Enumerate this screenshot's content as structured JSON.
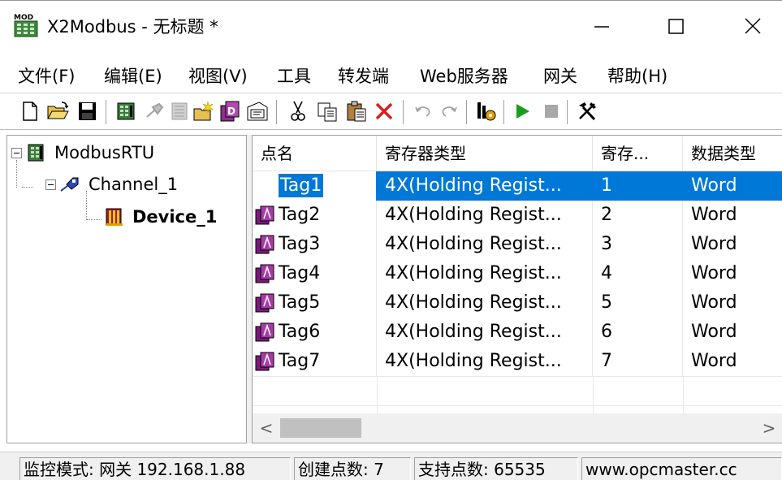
{
  "window": {
    "title": "X2Modbus - 无标题 *",
    "minimize_icon": "minimize-icon",
    "maximize_icon": "maximize-icon",
    "close_icon": "close-icon"
  },
  "menu": {
    "items": [
      {
        "label": "文件(F)"
      },
      {
        "label": "编辑(E)"
      },
      {
        "label": "视图(V)"
      },
      {
        "label": "工具"
      },
      {
        "label": "转发端"
      },
      {
        "label": "Web服务器"
      },
      {
        "label": "网关"
      },
      {
        "label": "帮助(H)"
      }
    ]
  },
  "toolbar": {
    "buttons": [
      "new-icon",
      "open-icon",
      "save-icon",
      "channel-icon",
      "link-icon",
      "device-icon",
      "new-tag-icon",
      "tag-db-icon",
      "properties-icon",
      "cut-icon",
      "copy-icon",
      "paste-icon",
      "delete-icon",
      "undo-icon",
      "redo-icon",
      "run-config-icon",
      "start-icon",
      "stop-icon",
      "tools-icon"
    ]
  },
  "tree": {
    "root": {
      "label": "ModbusRTU"
    },
    "channel": {
      "label": "Channel_1"
    },
    "device": {
      "label": "Device_1"
    }
  },
  "list": {
    "headers": [
      "点名",
      "寄存器类型",
      "寄存...",
      "数据类型"
    ],
    "rows": [
      {
        "name": "Tag1",
        "register_type": "4X(Holding Regist...",
        "address": "1",
        "data_type": "Word"
      },
      {
        "name": "Tag2",
        "register_type": "4X(Holding Regist...",
        "address": "2",
        "data_type": "Word"
      },
      {
        "name": "Tag3",
        "register_type": "4X(Holding Regist...",
        "address": "3",
        "data_type": "Word"
      },
      {
        "name": "Tag4",
        "register_type": "4X(Holding Regist...",
        "address": "4",
        "data_type": "Word"
      },
      {
        "name": "Tag5",
        "register_type": "4X(Holding Regist...",
        "address": "5",
        "data_type": "Word"
      },
      {
        "name": "Tag6",
        "register_type": "4X(Holding Regist...",
        "address": "6",
        "data_type": "Word"
      },
      {
        "name": "Tag7",
        "register_type": "4X(Holding Regist...",
        "address": "7",
        "data_type": "Word"
      }
    ],
    "selected_row": "Tag1",
    "scroll_left": "<",
    "scroll_right": ">"
  },
  "status": {
    "mode": "监控模式: 网关 192.168.1.88",
    "created": "创建点数: 7",
    "supported": "支持点数: 65535",
    "website": "www.opcmaster.cc"
  },
  "colors": {
    "selection": "#0078d7",
    "start_green": "#1a9e1a",
    "delete_red": "#d81e1e"
  }
}
